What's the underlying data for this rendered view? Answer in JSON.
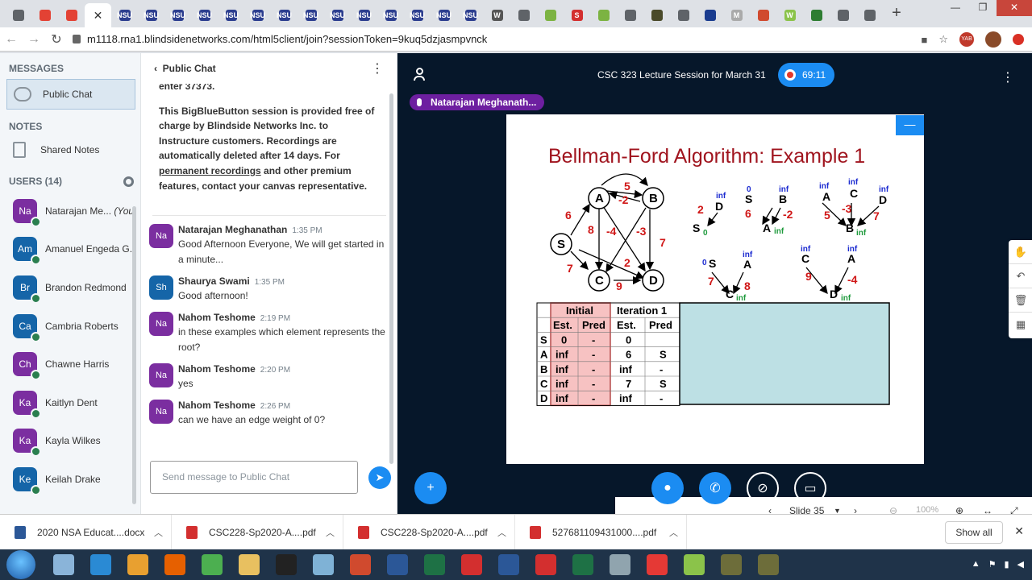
{
  "browser": {
    "tabs": [
      {
        "icon": "globe-icon",
        "color": "#5f6368",
        "glyph": ""
      },
      {
        "icon": "loading-icon",
        "color": "#e34234",
        "glyph": ""
      },
      {
        "icon": "loading-icon",
        "color": "#e34234",
        "glyph": ""
      },
      {
        "icon": "close-icon",
        "color": "#ffffff",
        "glyph": "✕",
        "active": true
      },
      {
        "icon": "nsu-icon",
        "color": "#2c3e8f",
        "glyph": "NSU"
      },
      {
        "icon": "nsu-icon",
        "color": "#2c3e8f",
        "glyph": "NSU"
      },
      {
        "icon": "nsu-icon",
        "color": "#2c3e8f",
        "glyph": "NSU"
      },
      {
        "icon": "nsu-icon",
        "color": "#2c3e8f",
        "glyph": "NSU"
      },
      {
        "icon": "nsu-icon",
        "color": "#2c3e8f",
        "glyph": "NSU"
      },
      {
        "icon": "nsu-icon",
        "color": "#2c3e8f",
        "glyph": "NSU"
      },
      {
        "icon": "nsu-icon",
        "color": "#2c3e8f",
        "glyph": "NSU"
      },
      {
        "icon": "nsu-icon",
        "color": "#2c3e8f",
        "glyph": "NSU"
      },
      {
        "icon": "nsu-icon",
        "color": "#2c3e8f",
        "glyph": "NSU"
      },
      {
        "icon": "nsu-icon",
        "color": "#2c3e8f",
        "glyph": "NSU"
      },
      {
        "icon": "nsu-icon",
        "color": "#2c3e8f",
        "glyph": "NSU"
      },
      {
        "icon": "nsu-icon",
        "color": "#2c3e8f",
        "glyph": "NSU"
      },
      {
        "icon": "nsu-icon",
        "color": "#2c3e8f",
        "glyph": "NSU"
      },
      {
        "icon": "nsu-icon",
        "color": "#2c3e8f",
        "glyph": "NSU"
      },
      {
        "icon": "wikipedia-icon",
        "color": "#555555",
        "glyph": "W"
      },
      {
        "icon": "globe-icon",
        "color": "#5f6368",
        "glyph": ""
      },
      {
        "icon": "smiley-icon",
        "color": "#7cb342",
        "glyph": ""
      },
      {
        "icon": "s-icon",
        "color": "#d32f2f",
        "glyph": "S"
      },
      {
        "icon": "smiley-icon",
        "color": "#7cb342",
        "glyph": ""
      },
      {
        "icon": "globe-icon",
        "color": "#5f6368",
        "glyph": ""
      },
      {
        "icon": "site-icon",
        "color": "#4a4a2a",
        "glyph": ""
      },
      {
        "icon": "mail-icon",
        "color": "#5f6368",
        "glyph": ""
      },
      {
        "icon": "shield-icon",
        "color": "#1a3c8f",
        "glyph": ""
      },
      {
        "icon": "math-icon",
        "color": "#aaaaaa",
        "glyph": "M"
      },
      {
        "icon": "chrome-ext-icon",
        "color": "#d04a2e",
        "glyph": ""
      },
      {
        "icon": "w-icon",
        "color": "#8bc34a",
        "glyph": "W"
      },
      {
        "icon": "arrow-icon",
        "color": "#2e7d32",
        "glyph": ""
      },
      {
        "icon": "globe-icon",
        "color": "#5f6368",
        "glyph": ""
      },
      {
        "icon": "globe-icon",
        "color": "#5f6368",
        "glyph": ""
      }
    ],
    "url": "m1118.rna1.blindsidenetworks.com/html5client/join?sessionToken=9kuq5dzjasmpvnck"
  },
  "sidebar": {
    "messages_title": "MESSAGES",
    "public_chat": "Public Chat",
    "notes_title": "NOTES",
    "shared_notes": "Shared Notes",
    "users_title": "USERS (14)",
    "users": [
      {
        "initials": "Na",
        "name": "Natarajan Me...",
        "you": "(You)",
        "color": "#7b2ea0"
      },
      {
        "initials": "Am",
        "name": "Amanuel Engeda G...",
        "color": "#1565a8"
      },
      {
        "initials": "Br",
        "name": "Brandon Redmond",
        "color": "#1565a8"
      },
      {
        "initials": "Ca",
        "name": "Cambria Roberts",
        "color": "#1565a8"
      },
      {
        "initials": "Ch",
        "name": "Chawne Harris",
        "color": "#7b2ea0"
      },
      {
        "initials": "Ka",
        "name": "Kaitlyn Dent",
        "color": "#7b2ea0"
      },
      {
        "initials": "Ka",
        "name": "Kayla Wilkes",
        "color": "#7b2ea0"
      },
      {
        "initials": "Ke",
        "name": "Keilah Drake",
        "color": "#1565a8"
      }
    ]
  },
  "chat": {
    "title": "Public Chat",
    "welcome_cut": "enter 37373.",
    "welcome_a": "This BigBlueButton session is provided free of charge by Blindside Networks Inc. to Instructure customers. Recordings are automatically deleted after 14 days. For ",
    "welcome_link": "permanent recordings",
    "welcome_b": " and other premium features, contact your canvas representative.",
    "messages": [
      {
        "initials": "Na",
        "color": "#7b2ea0",
        "name": "Natarajan Meghanathan",
        "time": "1:35 PM",
        "text": "Good Afternoon Everyone, We will get started in a minute..."
      },
      {
        "initials": "Sh",
        "color": "#1565a8",
        "name": "Shaurya Swami",
        "time": "1:35 PM",
        "text": "Good afternoon!"
      },
      {
        "initials": "Na",
        "color": "#7b2ea0",
        "name": "Nahom Teshome",
        "time": "2:19 PM",
        "text": "in these examples which element represents the root?"
      },
      {
        "initials": "Na",
        "color": "#7b2ea0",
        "name": "Nahom Teshome",
        "time": "2:20 PM",
        "text": "yes"
      },
      {
        "initials": "Na",
        "color": "#7b2ea0",
        "name": "Nahom Teshome",
        "time": "2:26 PM",
        "text": "can we have an edge weight of 0?"
      }
    ],
    "input_placeholder": "Send message to Public Chat"
  },
  "presentation": {
    "session_title": "CSC 323 Lecture Session for March 31",
    "timer": "69:11",
    "talker": "Natarajan Meghanath...",
    "slide_title": "Bellman-Ford Algorithm: Example 1",
    "slide_label": "Slide 35",
    "zoom": "100%"
  },
  "slide_content": {
    "graph_nodes": [
      "A",
      "B",
      "S",
      "C",
      "D"
    ],
    "graph_edge_weights": [
      "5",
      "-2",
      "6",
      "8",
      "-4",
      "-3",
      "7",
      "2",
      "7",
      "9"
    ],
    "trees": [
      {
        "labels": [
          "inf",
          "D",
          "2",
          "S",
          "0"
        ]
      },
      {
        "labels": [
          "0",
          "S",
          "inf",
          "B",
          "6",
          "-2",
          "A",
          "inf"
        ]
      },
      {
        "labels": [
          "inf",
          "A",
          "inf",
          "C",
          "inf",
          "D",
          "5",
          "-3",
          "7",
          "B",
          "inf"
        ]
      },
      {
        "labels": [
          "0",
          "S",
          "inf",
          "A",
          "7",
          "8",
          "C",
          "inf"
        ]
      },
      {
        "labels": [
          "inf",
          "C",
          "inf",
          "A",
          "9",
          "-4",
          "D",
          "inf"
        ]
      }
    ],
    "table": {
      "group_headers": [
        "Initial",
        "Iteration 1"
      ],
      "sub_headers": [
        "Est.",
        "Pred",
        "Est.",
        "Pred"
      ],
      "rows": [
        {
          "node": "S",
          "init_est": "0",
          "init_pred": "-",
          "it1_est": "0",
          "it1_pred": ""
        },
        {
          "node": "A",
          "init_est": "inf",
          "init_pred": "-",
          "it1_est": "6",
          "it1_pred": "S"
        },
        {
          "node": "B",
          "init_est": "inf",
          "init_pred": "-",
          "it1_est": "inf",
          "it1_pred": "-"
        },
        {
          "node": "C",
          "init_est": "inf",
          "init_pred": "-",
          "it1_est": "7",
          "it1_pred": "S"
        },
        {
          "node": "D",
          "init_est": "inf",
          "init_pred": "-",
          "it1_est": "inf",
          "it1_pred": "-"
        }
      ]
    }
  },
  "downloads": [
    {
      "name": "2020 NSA Educat....docx",
      "icon": "word-doc-icon",
      "color": "#2b5797"
    },
    {
      "name": "CSC228-Sp2020-A....pdf",
      "icon": "pdf-icon",
      "color": "#d32f2f"
    },
    {
      "name": "CSC228-Sp2020-A....pdf",
      "icon": "pdf-icon",
      "color": "#d32f2f"
    },
    {
      "name": "527681109431000....pdf",
      "icon": "pdf-icon",
      "color": "#d32f2f"
    }
  ],
  "download_bar": {
    "show_all": "Show all"
  },
  "taskbar": {
    "apps": [
      {
        "icon": "tools-icon",
        "color": "#8ab4d9"
      },
      {
        "icon": "ie-icon",
        "color": "#2a8ad4"
      },
      {
        "icon": "media-icon",
        "color": "#e8a030"
      },
      {
        "icon": "firefox-icon",
        "color": "#e66000"
      },
      {
        "icon": "chrome-icon",
        "color": "#4caf50"
      },
      {
        "icon": "folder-icon",
        "color": "#e8c060"
      },
      {
        "icon": "terminal-icon",
        "color": "#222222"
      },
      {
        "icon": "notepad-icon",
        "color": "#7fb2d6"
      },
      {
        "icon": "powerpoint-icon",
        "color": "#d04a2e"
      },
      {
        "icon": "word-icon",
        "color": "#2b5797"
      },
      {
        "icon": "excel-icon",
        "color": "#1e7145"
      },
      {
        "icon": "acrobat-icon",
        "color": "#d32f2f"
      },
      {
        "icon": "word-icon",
        "color": "#2b5797"
      },
      {
        "icon": "paint-icon",
        "color": "#d32f2f"
      },
      {
        "icon": "excel-icon",
        "color": "#1e7145"
      },
      {
        "icon": "calculator-icon",
        "color": "#90a4ae"
      },
      {
        "icon": "firstaid-icon",
        "color": "#e53935"
      },
      {
        "icon": "chart-icon",
        "color": "#8bc34a"
      },
      {
        "icon": "usb-icon",
        "color": "#6d6d3a"
      },
      {
        "icon": "usb-icon",
        "color": "#6d6d3a"
      }
    ]
  }
}
